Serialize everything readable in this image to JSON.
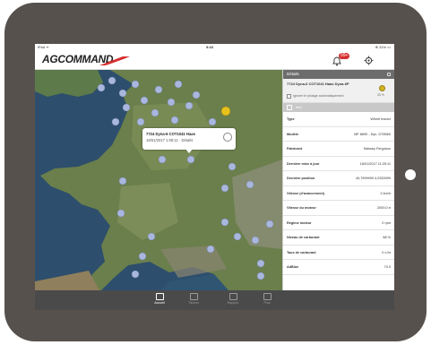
{
  "status_bar": {
    "carrier": "iPad ᯤ",
    "time": "9:43",
    "battery": "⊕ 31% ▭"
  },
  "app": {
    "logo_text": "AGCOMMAND",
    "notification_count": "99+"
  },
  "map_popup": {
    "title": "7724 Dyna-6 COT1041 Haas",
    "subtitle": "16/01/2017 1:08:11 · Détails"
  },
  "panel": {
    "header_title": "Détails",
    "vehicle_name": "7724 Dyna-6 COT1041 Haas Dyna-6P",
    "track_label": "Ignorer le pistage automatiquement",
    "status_text": "33 %",
    "tab_label": "Info",
    "rows": [
      {
        "label": "Type",
        "value": "Wheel tractor"
      },
      {
        "label": "Modèle",
        "value": "MF 8690 - Dyn. DT8560"
      },
      {
        "label": "Fabricant",
        "value": "Massey Ferguson"
      },
      {
        "label": "Dernière mise à jour",
        "value": "16/01/2017 11:25:11"
      },
      {
        "label": "Dernière position",
        "value": "49,7999999 4,0333999"
      },
      {
        "label": "Vitesse (d'avancement)",
        "value": "0 km/h"
      },
      {
        "label": "Vitesse du moteur",
        "value": "2000,0 tr"
      },
      {
        "label": "Régime moteur",
        "value": "0 rpm"
      },
      {
        "label": "Niveau de carburant",
        "value": "88 %"
      },
      {
        "label": "Taux de carburant",
        "value": "0 L/hr"
      },
      {
        "label": "AdBlue",
        "value": "70.0"
      }
    ]
  },
  "tabbar": {
    "items": [
      {
        "label": "Accueil"
      },
      {
        "label": "Tâches"
      },
      {
        "label": "Rapport"
      },
      {
        "label": "Plus"
      }
    ]
  },
  "colors": {
    "tablet_bezel": "#57514d",
    "panel_header": "#6c6c6c",
    "marker_blue": "#a9b6dd",
    "marker_selected": "#e7c21e",
    "tabbar": "#4a4a4a",
    "badge": "#d62c2c"
  }
}
